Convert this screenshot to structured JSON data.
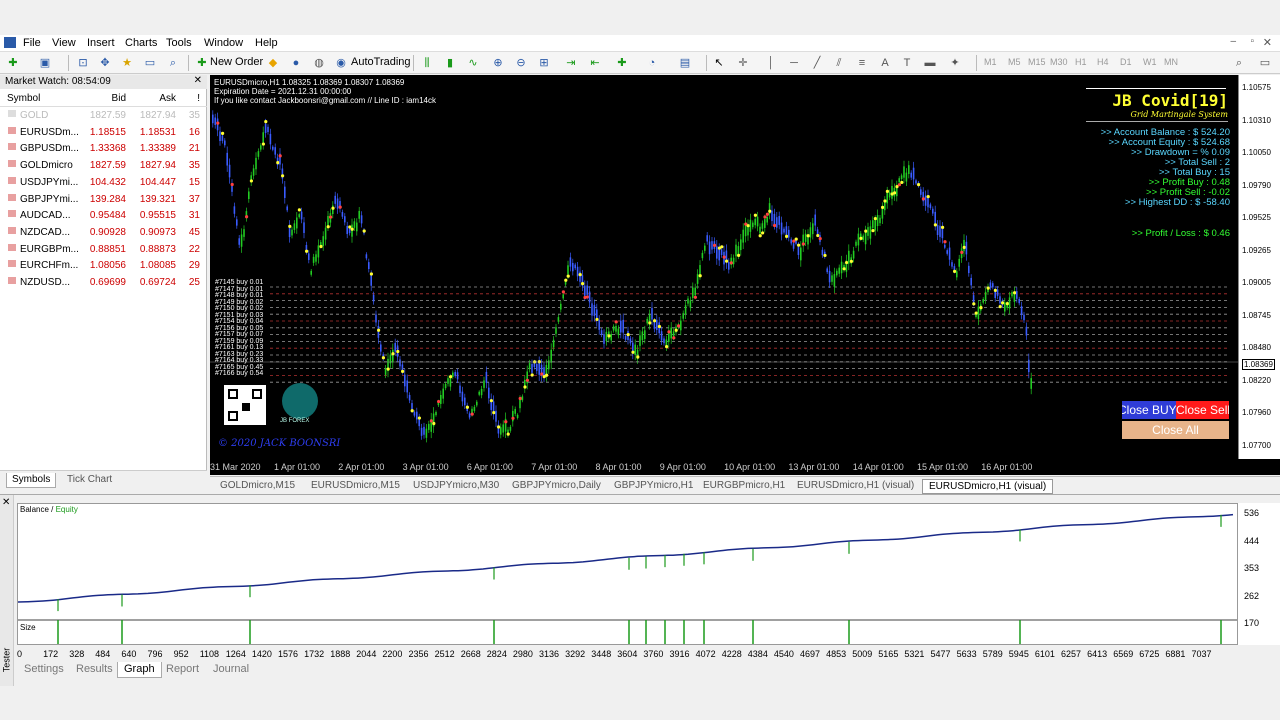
{
  "menu": [
    "File",
    "View",
    "Insert",
    "Charts",
    "Tools",
    "Window",
    "Help"
  ],
  "toolbar": {
    "new_order": "New Order",
    "autotrading": "AutoTrading",
    "timeframes": [
      "M1",
      "M5",
      "M15",
      "M30",
      "H1",
      "H4",
      "D1",
      "W1",
      "MN"
    ]
  },
  "market_watch": {
    "title": "Market Watch: 08:54:09",
    "headers": {
      "symbol": "Symbol",
      "bid": "Bid",
      "ask": "Ask",
      "spread": "!"
    },
    "rows": [
      {
        "symbol": "GOLD",
        "bid": "1827.59",
        "ask": "1827.94",
        "spread": "35"
      },
      {
        "symbol": "EURUSDm...",
        "bid": "1.18515",
        "ask": "1.18531",
        "spread": "16"
      },
      {
        "symbol": "GBPUSDm...",
        "bid": "1.33368",
        "ask": "1.33389",
        "spread": "21"
      },
      {
        "symbol": "GOLDmicro",
        "bid": "1827.59",
        "ask": "1827.94",
        "spread": "35"
      },
      {
        "symbol": "USDJPYmi...",
        "bid": "104.432",
        "ask": "104.447",
        "spread": "15"
      },
      {
        "symbol": "GBPJPYmi...",
        "bid": "139.284",
        "ask": "139.321",
        "spread": "37"
      },
      {
        "symbol": "AUDCAD...",
        "bid": "0.95484",
        "ask": "0.95515",
        "spread": "31"
      },
      {
        "symbol": "NZDCAD...",
        "bid": "0.90928",
        "ask": "0.90973",
        "spread": "45"
      },
      {
        "symbol": "EURGBPm...",
        "bid": "0.88851",
        "ask": "0.88873",
        "spread": "22"
      },
      {
        "symbol": "EURCHFm...",
        "bid": "1.08056",
        "ask": "1.08085",
        "spread": "29"
      },
      {
        "symbol": "NZDUSD...",
        "bid": "0.69699",
        "ask": "0.69724",
        "spread": "25"
      }
    ],
    "tabs": [
      "Symbols",
      "Tick Chart"
    ]
  },
  "chart": {
    "header_line1": "EURUSDmicro,H1  1.08325 1.08369 1.08307 1.08369",
    "header_line2": "Expiration Date = 2021.12.31 00:00:00",
    "header_line3": "If you like contact Jackboonsri@gmail.com // Line ID : iam14ck",
    "ea_title": "JB Covid[19]",
    "ea_subtitle": "Grid Martingale System",
    "stats": [
      {
        "text": ">> Account Balance  : $ 524.20",
        "color": "#5ad7ff"
      },
      {
        "text": ">> Account Equity  : $ 524.68",
        "color": "#5ad7ff"
      },
      {
        "text": ">> Drawdown = % 0.09",
        "color": "#5ad7ff"
      },
      {
        "text": ">> Total Sell  : 2",
        "color": "#5ad7ff"
      },
      {
        "text": ">> Total Buy  : 15",
        "color": "#5ad7ff"
      },
      {
        "text": ">> Profit Buy  : 0.48",
        "color": "#33ff33"
      },
      {
        "text": ">> Profit Sell  : -0.02",
        "color": "#33ff33"
      },
      {
        "text": ">> Highest DD  : $ -58.40",
        "color": "#5ad7ff"
      }
    ],
    "profit_loss": ">> Profit / Loss  : $ 0.46",
    "buttons": {
      "close_buy": "Close BUY",
      "close_sell": "Close Sell",
      "close_all": "Close All"
    },
    "order_labels": [
      "#7145 buy 0.01",
      "#7147 buy 0.01",
      "#7148 buy 0.01",
      "#7149 buy 0.02",
      "#7150 buy 0.02",
      "#7151 buy 0.03",
      "#7154 buy 0.04",
      "#7156 buy 0.05",
      "#7157 buy 0.07",
      "#7159 buy 0.09",
      "#7161 buy 0.13",
      "#7163 buy 0.23",
      "#7164 buy 0.33",
      "#7165 buy 0.45",
      "#7166 buy 0.54"
    ],
    "logo_text": "JB FOREX",
    "copyright": "© 2020 JACK BOONSRI",
    "price_labels": [
      "1.10575",
      "1.10310",
      "1.10050",
      "1.09790",
      "1.09525",
      "1.09265",
      "1.09005",
      "1.08745",
      "1.08480",
      "1.08369",
      "1.08220",
      "1.07960",
      "1.07700"
    ],
    "current_price": "1.08369",
    "time_labels": [
      "31 Mar 2020",
      "1 Apr 01:00",
      "2 Apr 01:00",
      "3 Apr 01:00",
      "6 Apr 01:00",
      "7 Apr 01:00",
      "8 Apr 01:00",
      "9 Apr 01:00",
      "10 Apr 01:00",
      "13 Apr 01:00",
      "14 Apr 01:00",
      "15 Apr 01:00",
      "16 Apr 01:00"
    ],
    "tabs": [
      "GOLDmicro,M15",
      "EURUSDmicro,M15",
      "USDJPYmicro,M30",
      "GBPJPYmicro,Daily",
      "GBPJPYmicro,H1",
      "EURGBPmicro,H1",
      "EURUSDmicro,H1 (visual)",
      "EURUSDmicro,H1 (visual)"
    ]
  },
  "tester": {
    "side_label": "Tester",
    "legend_balance": "Balance",
    "legend_sep": " / ",
    "legend_equity": "Equity",
    "size_label": "Size",
    "y_labels": [
      "536",
      "444",
      "353",
      "262",
      "170"
    ],
    "x_labels": [
      "0",
      "172",
      "328",
      "484",
      "640",
      "796",
      "952",
      "1108",
      "1264",
      "1420",
      "1576",
      "1732",
      "1888",
      "2044",
      "2200",
      "2356",
      "2512",
      "2668",
      "2824",
      "2980",
      "3136",
      "3292",
      "3448",
      "3604",
      "3760",
      "3916",
      "4072",
      "4228",
      "4384",
      "4540",
      "4697",
      "4853",
      "5009",
      "5165",
      "5321",
      "5477",
      "5633",
      "5789",
      "5945",
      "6101",
      "6257",
      "6413",
      "6569",
      "6725",
      "6881",
      "7037"
    ],
    "tabs": [
      "Settings",
      "Results",
      "Graph",
      "Report",
      "Journal"
    ],
    "active_tab": "Graph"
  }
}
